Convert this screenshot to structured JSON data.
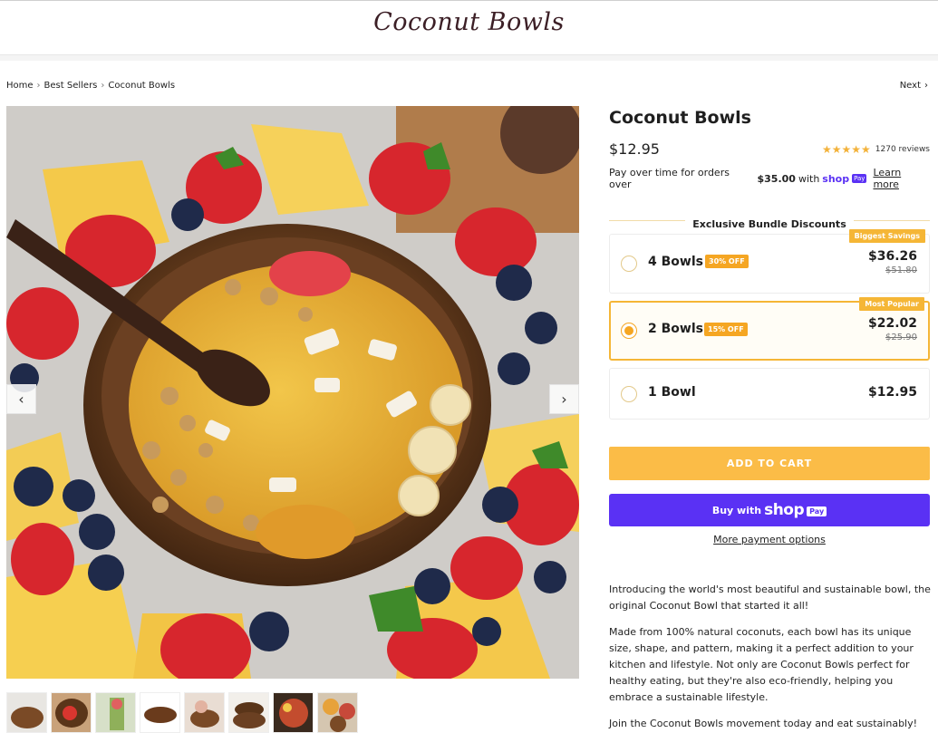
{
  "header": {
    "logo_text": "Coconut Bowls"
  },
  "breadcrumb": {
    "items": [
      "Home",
      "Best Sellers",
      "Coconut Bowls"
    ],
    "next_label": "Next"
  },
  "gallery": {
    "main_image_alt": "coconut bowl with fruit",
    "thumbnail_count": 8
  },
  "product": {
    "title": "Coconut Bowls",
    "price": "$12.95",
    "stars": "★★★★★",
    "reviews": "1270 reviews",
    "pay_over_prefix": "Pay over time for orders over",
    "pay_over_amount": "$35.00",
    "pay_over_with": "with",
    "shop_word": "shop",
    "pay_badge": "Pay",
    "learn_more": "Learn more"
  },
  "bundles": {
    "heading": "Exclusive Bundle Discounts",
    "options": [
      {
        "label": "4 Bowls",
        "discount": "30% OFF",
        "price": "$36.26",
        "old_price": "$51.80",
        "ribbon": "Biggest Savings",
        "selected": false
      },
      {
        "label": "2 Bowls",
        "discount": "15% OFF",
        "price": "$22.02",
        "old_price": "$25.90",
        "ribbon": "Most Popular",
        "selected": true
      },
      {
        "label": "1 Bowl",
        "discount": "",
        "price": "$12.95",
        "old_price": "",
        "ribbon": "",
        "selected": false
      }
    ]
  },
  "actions": {
    "add_to_cart": "ADD TO CART",
    "buy_with": "Buy with",
    "shop_word": "shop",
    "pay_badge": "Pay",
    "more_payment": "More payment options"
  },
  "description": [
    "Introducing the world's most beautiful and sustainable bowl, the original Coconut Bowl that started it all!",
    "Made from 100% natural coconuts, each bowl has its unique size, shape, and pattern, making it a perfect addition to your kitchen and lifestyle. Not only are Coconut Bowls perfect for healthy eating, but they're also eco-friendly, helping you embrace a sustainable lifestyle.",
    "Join the Coconut Bowls movement today and eat sustainably!"
  ],
  "colors": {
    "accent": "#fbbc47",
    "shop_pay": "#5a31f4",
    "logo": "#3c1f26",
    "star": "#f3b23a"
  }
}
